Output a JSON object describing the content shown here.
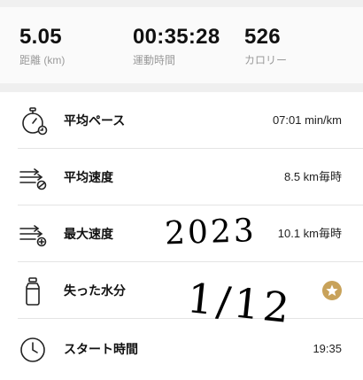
{
  "summary": {
    "distance": {
      "value": "5.05",
      "label": "距離 (km)"
    },
    "duration": {
      "value": "00:35:28",
      "label": "運動時間"
    },
    "calories": {
      "value": "526",
      "label": "カロリー"
    }
  },
  "metrics": [
    {
      "label": "平均ペース",
      "value": "07:01 min/km",
      "icon": "stopwatch-pace-icon"
    },
    {
      "label": "平均速度",
      "value": "8.5 km毎時",
      "icon": "speed-average-icon"
    },
    {
      "label": "最大速度",
      "value": "10.1 km毎時",
      "icon": "speed-max-icon"
    },
    {
      "label": "失った水分",
      "value": "",
      "icon": "water-bottle-icon",
      "badge_icon": "star-badge-icon"
    },
    {
      "label": "スタート時間",
      "value": "19:35",
      "icon": "clock-icon"
    }
  ],
  "handwriting": {
    "year": "2023",
    "date": "1/12"
  },
  "colors": {
    "badge": "#c8a25a",
    "divider": "#e4e4e4",
    "label_gray": "#9a9a9a"
  }
}
